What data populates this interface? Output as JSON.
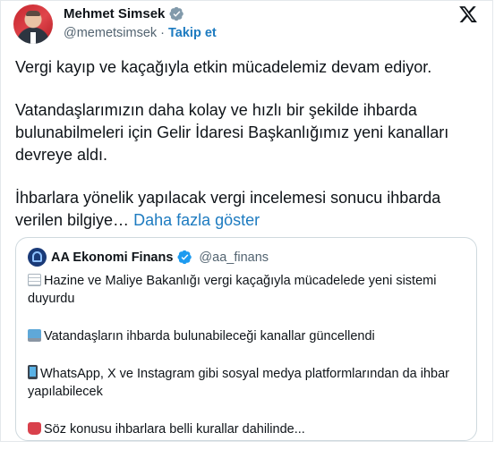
{
  "author": {
    "name": "Mehmet Simsek",
    "handle": "@memetsimsek",
    "separator": "·",
    "follow_label": "Takip et",
    "icons": {
      "verified": "verified-badge-icon",
      "platform": "x-logo-icon"
    },
    "colors": {
      "verified_gray": "#829aab",
      "link_blue": "#1d7bc0"
    }
  },
  "tweet": {
    "paragraphs": [
      "Vergi kayıp ve kaçağıyla etkin mücadelemiz devam ediyor.",
      "Vatandaşlarımızın daha kolay ve hızlı bir şekilde ihbarda bulunabilmeleri için Gelir İdaresi Başkanlığımız yeni kanalları devreye aldı.",
      "İhbarlara yönelik yapılacak vergi incelemesi sonucu ihbarda verilen bilgiye…"
    ],
    "more_label": "Daha fazla göster"
  },
  "quote": {
    "name": "AA Ekonomi Finans",
    "handle": "@aa_finans",
    "items": [
      {
        "icon": "document-icon",
        "text": "Hazine ve Maliye Bakanlığı vergi kaçağıyla mücadelede yeni sistemi duyurdu"
      },
      {
        "icon": "laptop-icon",
        "text": "Vatandaşların ihbarda bulunabileceği kanallar güncellendi"
      },
      {
        "icon": "phone-icon",
        "text": "WhatsApp, X ve Instagram gibi sosyal medya platformlarından da ihbar yapılabilecek"
      },
      {
        "icon": "bag-icon",
        "text": "Söz konusu ihbarlara belli kurallar dahilinde..."
      }
    ]
  }
}
